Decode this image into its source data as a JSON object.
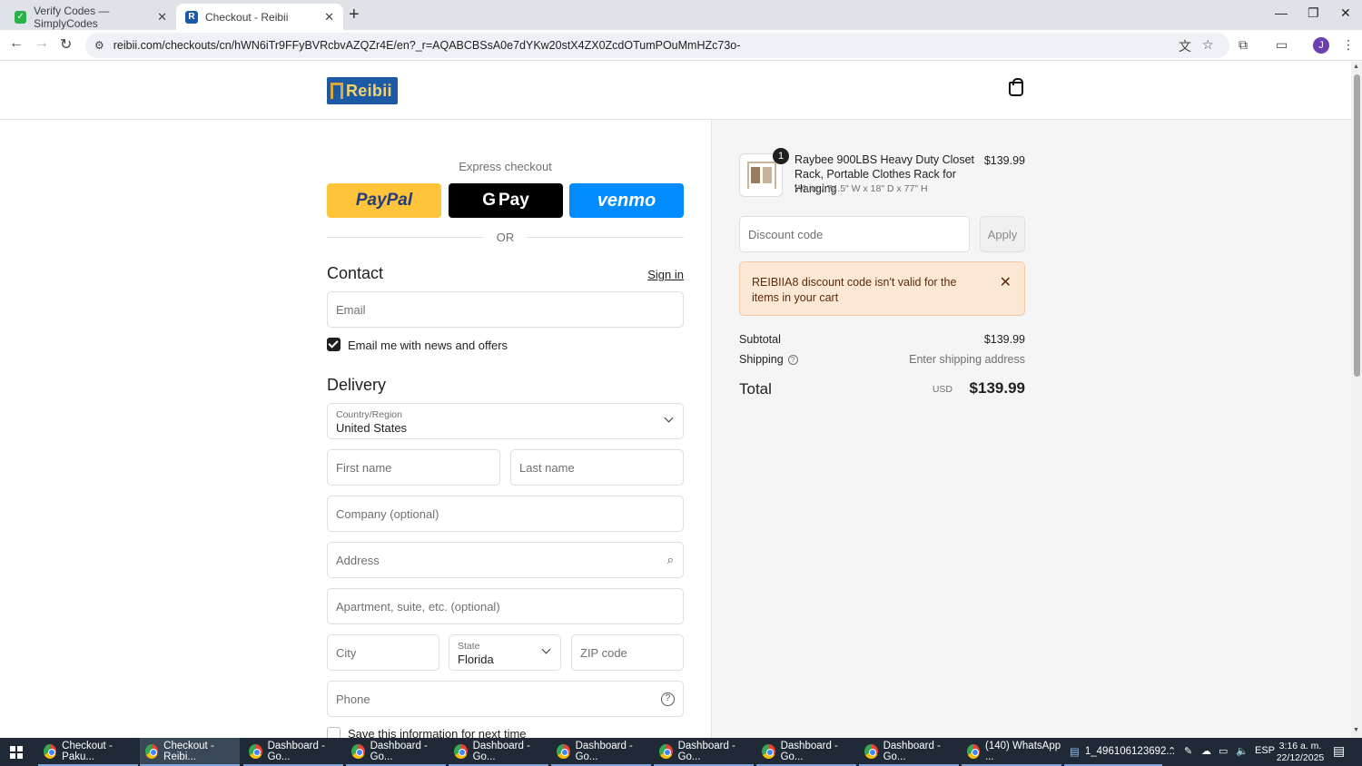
{
  "browser": {
    "tabs": [
      {
        "title": "Verify Codes — SimplyCodes",
        "active": false
      },
      {
        "title": "Checkout - Reibii",
        "active": true
      }
    ],
    "url": "reibii.com/checkouts/cn/hWN6iTr9FFyBVRcbvAZQZr4E/en?_r=AQABCBSsA0e7dYKw20stX4ZX0ZcdOTumPOuMmHZc73o-",
    "profile_initial": "J"
  },
  "store": {
    "logo_text": "Reibii"
  },
  "express": {
    "label": "Express checkout",
    "paypal": "PayPal",
    "gpay": "Pay",
    "venmo": "venmo",
    "or": "OR"
  },
  "contact": {
    "title": "Contact",
    "sign_in": "Sign in",
    "email_placeholder": "Email",
    "newsletter_label": "Email me with news and offers",
    "newsletter_checked": true
  },
  "delivery": {
    "title": "Delivery",
    "country_label": "Country/Region",
    "country_value": "United States",
    "first_name": "First name",
    "last_name": "Last name",
    "company": "Company (optional)",
    "address": "Address",
    "apartment": "Apartment, suite, etc. (optional)",
    "city": "City",
    "state_label": "State",
    "state_value": "Florida",
    "zip": "ZIP code",
    "phone": "Phone",
    "save_info": "Save this information for next time"
  },
  "summary": {
    "item": {
      "quantity": "1",
      "name": "Raybee 900LBS Heavy Duty Closet Rack, Portable Clothes Rack for Hanging",
      "variant": "White / 74.5\" W x 18\" D x 77\" H",
      "price": "$139.99"
    },
    "discount_placeholder": "Discount code",
    "apply": "Apply",
    "error": "REIBIIA8 discount code isn't valid for the items in your cart",
    "subtotal_label": "Subtotal",
    "subtotal_value": "$139.99",
    "shipping_label": "Shipping",
    "shipping_value": "Enter shipping address",
    "total_label": "Total",
    "currency": "USD",
    "total_value": "$139.99"
  },
  "taskbar": {
    "items": [
      "Checkout - Paku...",
      "Checkout - Reibi...",
      "Dashboard - Go...",
      "Dashboard - Go...",
      "Dashboard - Go...",
      "Dashboard - Go...",
      "Dashboard - Go...",
      "Dashboard - Go...",
      "Dashboard - Go...",
      "(140) WhatsApp ...",
      "1_496106123692..."
    ],
    "lang": "ESP",
    "time": "3:16 a. m.",
    "date": "22/12/2025"
  },
  "colors": {
    "paypal_bg": "#ffc439",
    "venmo_bg": "#008cff",
    "alert_bg": "#fde8d6",
    "logo_bg": "#1d5aa6"
  }
}
